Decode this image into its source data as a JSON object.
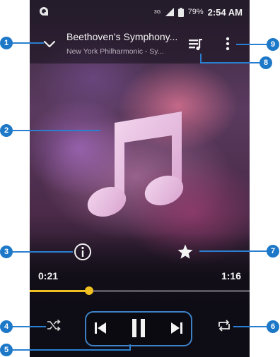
{
  "status_bar": {
    "network_label": "3G",
    "battery": "79%",
    "time": "2:54 AM"
  },
  "header": {
    "title": "Beethoven's Symphony...",
    "artist": "New York Philharmonic - Sy..."
  },
  "playback": {
    "elapsed": "0:21",
    "total": "1:16",
    "progress_fraction": 0.27
  },
  "icons": {
    "collapse": "chevron-down-icon",
    "queue": "queue-list-icon",
    "more": "more-vert-icon",
    "album_art": "music-note-icon",
    "info": "info-icon",
    "favorite": "star-icon",
    "shuffle": "shuffle-icon",
    "previous": "skip-previous-icon",
    "pause": "pause-icon",
    "next": "skip-next-icon",
    "repeat": "repeat-icon"
  },
  "callouts": [
    "1",
    "2",
    "3",
    "4",
    "5",
    "6",
    "7",
    "8",
    "9"
  ],
  "colors": {
    "seek_accent": "#f0c020",
    "callout_blue": "#1e78c8"
  }
}
